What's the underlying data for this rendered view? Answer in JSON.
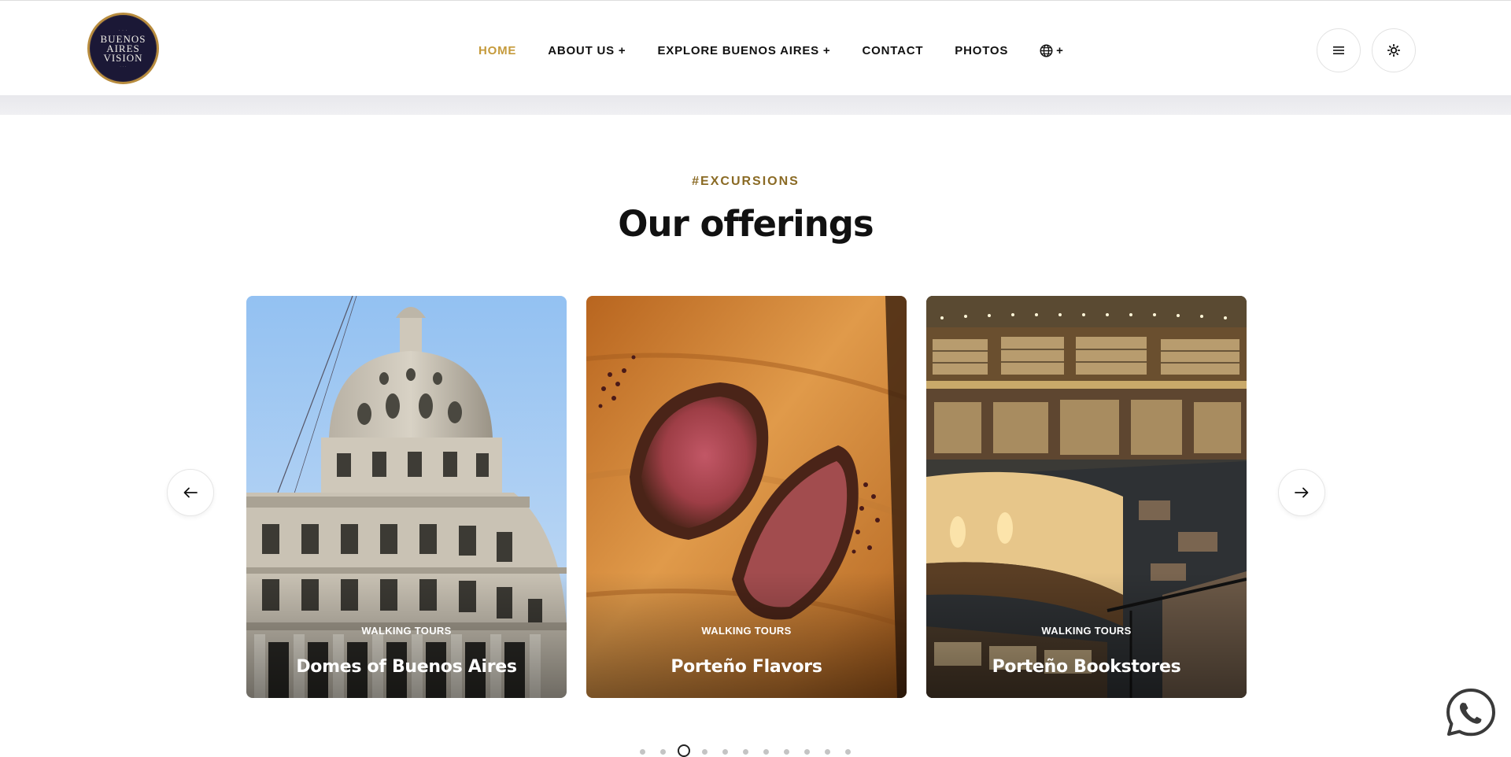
{
  "brand": {
    "logo_line1": "BUENOS",
    "logo_line2": "AIRES",
    "logo_line3": "VISION",
    "colors": {
      "gold": "#c59a3b",
      "navy": "#1b1836"
    }
  },
  "nav": {
    "items": [
      {
        "label": "HOME",
        "active": true
      },
      {
        "label": "ABOUT US +"
      },
      {
        "label": "EXPLORE BUENOS AIRES +"
      },
      {
        "label": "CONTACT"
      },
      {
        "label": "PHOTOS"
      }
    ],
    "language_suffix": "+",
    "language_icon": "globe-icon",
    "menu_icon": "hamburger-icon",
    "theme_icon": "sun-icon"
  },
  "section": {
    "kicker": "#EXCURSIONS",
    "title": "Our offerings"
  },
  "cards": [
    {
      "category": "WALKING TOURS",
      "title": "Domes of Buenos Aires"
    },
    {
      "category": "WALKING TOURS",
      "title": "Porteño Flavors"
    },
    {
      "category": "WALKING TOURS",
      "title": "Porteño Bookstores"
    }
  ],
  "carousel": {
    "prev_icon": "arrow-left-icon",
    "next_icon": "arrow-right-icon",
    "dot_count": 11,
    "active_dot": 2
  },
  "floating": {
    "icon": "whatsapp-icon"
  }
}
